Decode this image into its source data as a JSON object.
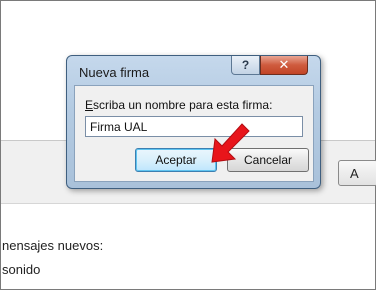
{
  "background": {
    "button_partial_label": "A",
    "lines": [
      "nensajes nuevos:",
      "sonido",
      "..."
    ]
  },
  "dialog": {
    "title": "Nueva firma",
    "help_label": "?",
    "close_label": "✕",
    "prompt_first_letter": "E",
    "prompt_rest": "scriba un nombre para esta firma:",
    "input_value": "Firma UAL",
    "accept_label": "Aceptar",
    "cancel_label": "Cancelar"
  },
  "annotation": {
    "arrow_color": "#e8151b",
    "arrow_icon": "red-arrow-icon"
  }
}
